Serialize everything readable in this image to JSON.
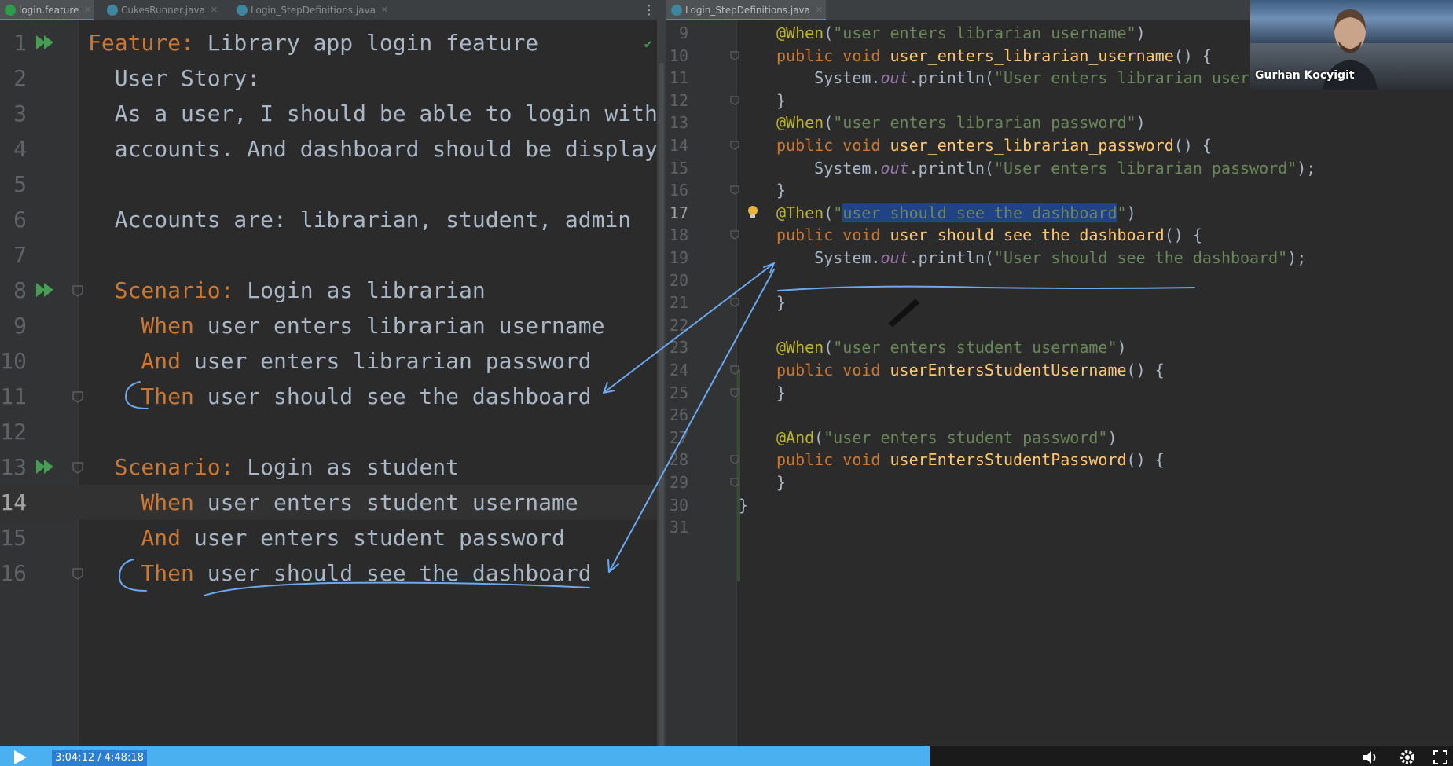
{
  "left_tabs": [
    {
      "label": "login.feature",
      "active": true,
      "icon": "cucumber-feature-icon"
    },
    {
      "label": "CukesRunner.java",
      "active": false,
      "icon": "java-class-icon"
    },
    {
      "label": "Login_StepDefinitions.java",
      "active": false,
      "icon": "java-class-icon"
    }
  ],
  "right_tabs": [
    {
      "label": "Login_StepDefinitions.java",
      "active": true,
      "icon": "java-class-icon"
    }
  ],
  "feature_lines": [
    {
      "num": "1",
      "kw": "Feature:",
      "text": " Library app login feature",
      "run": true
    },
    {
      "num": "2",
      "kw": "",
      "text": "  User Story:"
    },
    {
      "num": "3",
      "kw": "",
      "text": "  As a user, I should be able to login with"
    },
    {
      "num": "4",
      "kw": "",
      "text": "  accounts. And dashboard should be displaye"
    },
    {
      "num": "5",
      "kw": "",
      "text": ""
    },
    {
      "num": "6",
      "kw": "",
      "text": "  Accounts are: librarian, student, admin"
    },
    {
      "num": "7",
      "kw": "",
      "text": ""
    },
    {
      "num": "8",
      "kw": "  Scenario:",
      "text": " Login as librarian",
      "run": true,
      "fold": true
    },
    {
      "num": "9",
      "kw": "    When",
      "text": " user enters librarian username"
    },
    {
      "num": "10",
      "kw": "    And",
      "text": " user enters librarian password"
    },
    {
      "num": "11",
      "kw": "    Then",
      "text": " user should see the dashboard",
      "fold": true
    },
    {
      "num": "12",
      "kw": "",
      "text": ""
    },
    {
      "num": "13",
      "kw": "  Scenario:",
      "text": " Login as student",
      "run": true,
      "fold": true
    },
    {
      "num": "14",
      "kw": "    When",
      "text": " user enters student username",
      "current": true
    },
    {
      "num": "15",
      "kw": "    And",
      "text": " user enters student password"
    },
    {
      "num": "16",
      "kw": "    Then",
      "text": " user should see the dashboard",
      "fold": true
    }
  ],
  "java_lines": [
    {
      "num": "9",
      "parts": [
        [
          "ann",
          "@When"
        ],
        [
          "plain",
          "("
        ],
        [
          "str",
          "\"user enters librarian username\""
        ],
        [
          "plain",
          ")"
        ]
      ]
    },
    {
      "num": "10",
      "parts": [
        [
          "kw",
          "public void "
        ],
        [
          "meth",
          "user_enters_librarian_username"
        ],
        [
          "plain",
          "() {"
        ]
      ],
      "fold": true
    },
    {
      "num": "11",
      "parts": [
        [
          "plain",
          "    System."
        ],
        [
          "field",
          "out"
        ],
        [
          "plain",
          ".println("
        ],
        [
          "str",
          "\"User enters librarian username\""
        ],
        [
          "plain",
          ");"
        ]
      ]
    },
    {
      "num": "12",
      "parts": [
        [
          "plain",
          "}"
        ]
      ],
      "fold": true
    },
    {
      "num": "13",
      "parts": [
        [
          "ann",
          "@When"
        ],
        [
          "plain",
          "("
        ],
        [
          "str",
          "\"user enters librarian password\""
        ],
        [
          "plain",
          ")"
        ]
      ]
    },
    {
      "num": "14",
      "parts": [
        [
          "kw",
          "public void "
        ],
        [
          "meth",
          "user_enters_librarian_password"
        ],
        [
          "plain",
          "() {"
        ]
      ],
      "fold": true
    },
    {
      "num": "15",
      "parts": [
        [
          "plain",
          "    System."
        ],
        [
          "field",
          "out"
        ],
        [
          "plain",
          ".println("
        ],
        [
          "str",
          "\"User enters librarian password\""
        ],
        [
          "plain",
          ");"
        ]
      ]
    },
    {
      "num": "16",
      "parts": [
        [
          "plain",
          "}"
        ]
      ],
      "fold": true
    },
    {
      "num": "17",
      "parts": [
        [
          "ann",
          "@Then"
        ],
        [
          "plain",
          "("
        ],
        [
          "str",
          "\""
        ],
        [
          "sel",
          "user should see the dashboard"
        ],
        [
          "str",
          "\""
        ],
        [
          "plain",
          ")"
        ]
      ],
      "current": true,
      "bulb": true
    },
    {
      "num": "18",
      "parts": [
        [
          "kw",
          "public void "
        ],
        [
          "meth",
          "user_should_see_the_dashboard"
        ],
        [
          "plain",
          "() {"
        ]
      ],
      "fold": true
    },
    {
      "num": "19",
      "parts": [
        [
          "plain",
          "    System."
        ],
        [
          "field",
          "out"
        ],
        [
          "plain",
          ".println("
        ],
        [
          "str",
          "\"User should see the dashboard\""
        ],
        [
          "plain",
          ");"
        ]
      ]
    },
    {
      "num": "20",
      "parts": []
    },
    {
      "num": "21",
      "parts": [
        [
          "plain",
          "}"
        ]
      ],
      "fold": true
    },
    {
      "num": "22",
      "parts": []
    },
    {
      "num": "23",
      "parts": [
        [
          "ann",
          "@When"
        ],
        [
          "plain",
          "("
        ],
        [
          "str",
          "\"user enters student username\""
        ],
        [
          "plain",
          ")"
        ]
      ]
    },
    {
      "num": "24",
      "parts": [
        [
          "kw",
          "public void "
        ],
        [
          "meth",
          "userEntersStudentUsername"
        ],
        [
          "plain",
          "() {"
        ]
      ],
      "fold": true
    },
    {
      "num": "25",
      "parts": [
        [
          "plain",
          "}"
        ]
      ],
      "fold": true
    },
    {
      "num": "26",
      "parts": []
    },
    {
      "num": "27",
      "parts": [
        [
          "ann",
          "@And"
        ],
        [
          "plain",
          "("
        ],
        [
          "str",
          "\"user enters student password\""
        ],
        [
          "plain",
          ")"
        ]
      ]
    },
    {
      "num": "28",
      "parts": [
        [
          "kw",
          "public void "
        ],
        [
          "meth",
          "userEntersStudentPassword"
        ],
        [
          "plain",
          "() {"
        ]
      ],
      "fold": true
    },
    {
      "num": "29",
      "parts": [
        [
          "plain",
          "}"
        ]
      ],
      "fold": true
    },
    {
      "num": "30",
      "parts": [
        [
          "plain",
          "}"
        ]
      ],
      "outdent": true
    },
    {
      "num": "31",
      "parts": []
    }
  ],
  "webcam": {
    "name": "Gurhan Kocyigit"
  },
  "video": {
    "time": "3:04:12 / 4:48:18",
    "progress": 0.6396
  },
  "colors": {
    "accent": "#4a88c7",
    "keyword": "#cc7832",
    "annotation": "#bbb529",
    "string": "#6a8759",
    "method": "#ffc66d",
    "pen": "#6aa8f0"
  }
}
